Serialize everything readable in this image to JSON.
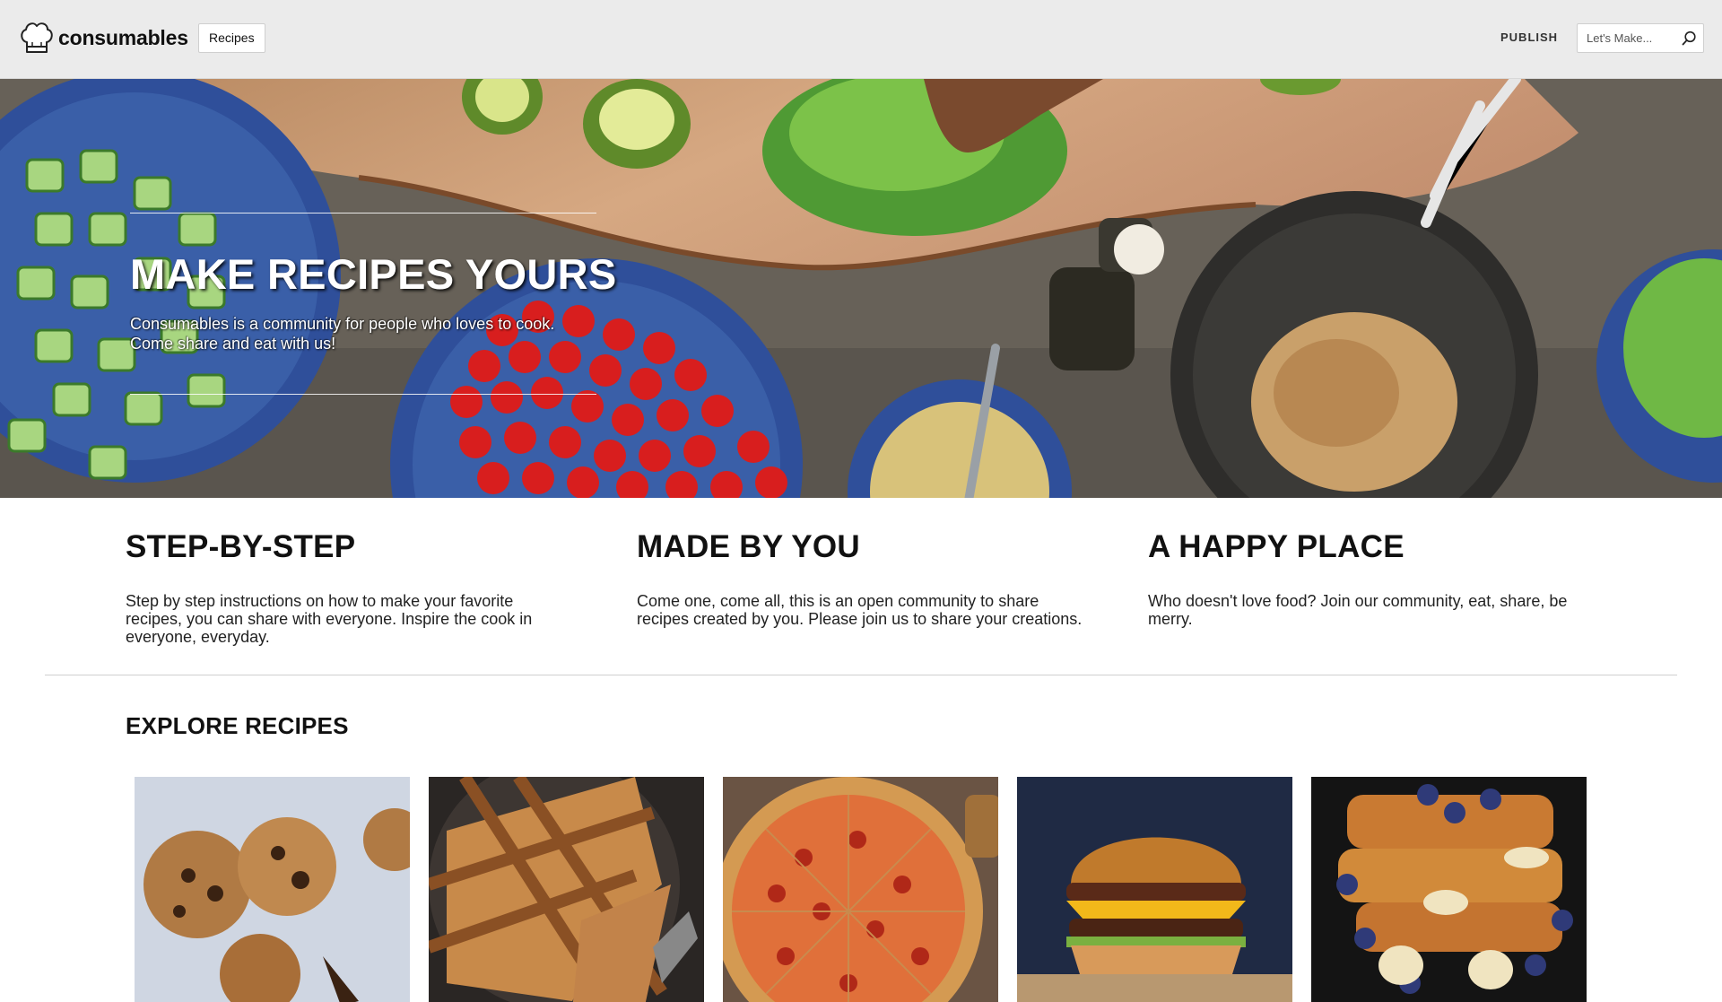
{
  "header": {
    "brand": "consumables",
    "nav_recipes_label": "Recipes",
    "publish_label": "PUBLISH",
    "search_placeholder": "Let's Make..."
  },
  "hero": {
    "title": "MAKE RECIPES YOURS",
    "subtitle_line1": "Consumables is a community for people who loves to cook.",
    "subtitle_line2": "Come share and eat with us!"
  },
  "features": [
    {
      "title": "STEP-BY-STEP",
      "text": "Step by step instructions on how to make your favorite recipes, you can share with everyone. Inspire the cook in everyone, everyday."
    },
    {
      "title": "MADE BY YOU",
      "text": "Come one, come all, this is an open community to share recipes created by you. Please join us to share your creations."
    },
    {
      "title": "A HAPPY PLACE",
      "text": "Who doesn't love food? Join our community, eat, share, be merry."
    }
  ],
  "explore": {
    "title": "EXPLORE RECIPES",
    "cards": [
      {
        "image": "cookies-photo"
      },
      {
        "image": "lattice-pie-photo"
      },
      {
        "image": "pizza-photo"
      },
      {
        "image": "burger-photo"
      },
      {
        "image": "french-toast-photo"
      }
    ]
  },
  "colors": {
    "header_bg": "#ebebeb",
    "text": "#111111",
    "divider": "#cfcfcf"
  }
}
